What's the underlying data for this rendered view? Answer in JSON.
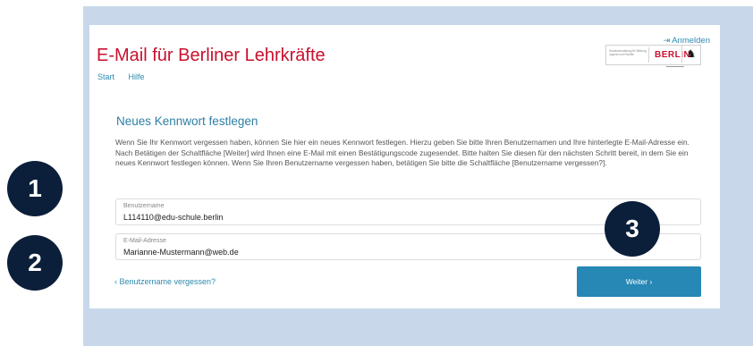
{
  "header": {
    "title": "E-Mail für Berliner Lehrkräfte",
    "login_icon": "login-arrow-icon",
    "login_label": "Anmelden",
    "nav": [
      "Start",
      "Hilfe"
    ],
    "logo": {
      "department": "Senatsverwaltung für Bildung, Jugend und Familie",
      "city": "BERLIN",
      "emblem": "berlin-bear-icon"
    }
  },
  "main": {
    "heading": "Neues Kennwort festlegen",
    "description": "Wenn Sie Ihr Kennwort vergessen haben, können Sie hier ein neues Kennwort festlegen. Hierzu geben Sie bitte Ihren Benutzernamen und Ihre hinterlegte E-Mail-Adresse ein. Nach Betätigen der Schaltfläche [Weiter] wird Ihnen eine E-Mail mit einen Bestätigungscode zugesendet. Bitte halten Sie diesen für den nächsten Schritt bereit, in dem Sie ein neues Kennwort festlegen können. Wenn Sie Ihren Benutzername vergessen haben, betätigen Sie bitte die Schaltfläche [Benutzername vergessen?].",
    "username": {
      "label": "Benutzername",
      "value": "L114110@edu-schule.berlin"
    },
    "email": {
      "label": "E-Mail-Adresse",
      "value": "Marianne-Mustermann@web.de"
    },
    "forgot_label": "‹ Benutzername vergessen?",
    "next_label": "Weiter ›"
  },
  "badges": [
    "1",
    "2",
    "3"
  ],
  "colors": {
    "background_panel": "#c8d8ea",
    "brand_red": "#c8102e",
    "accent_blue": "#2787b5",
    "badge": "#0b1f3a"
  }
}
